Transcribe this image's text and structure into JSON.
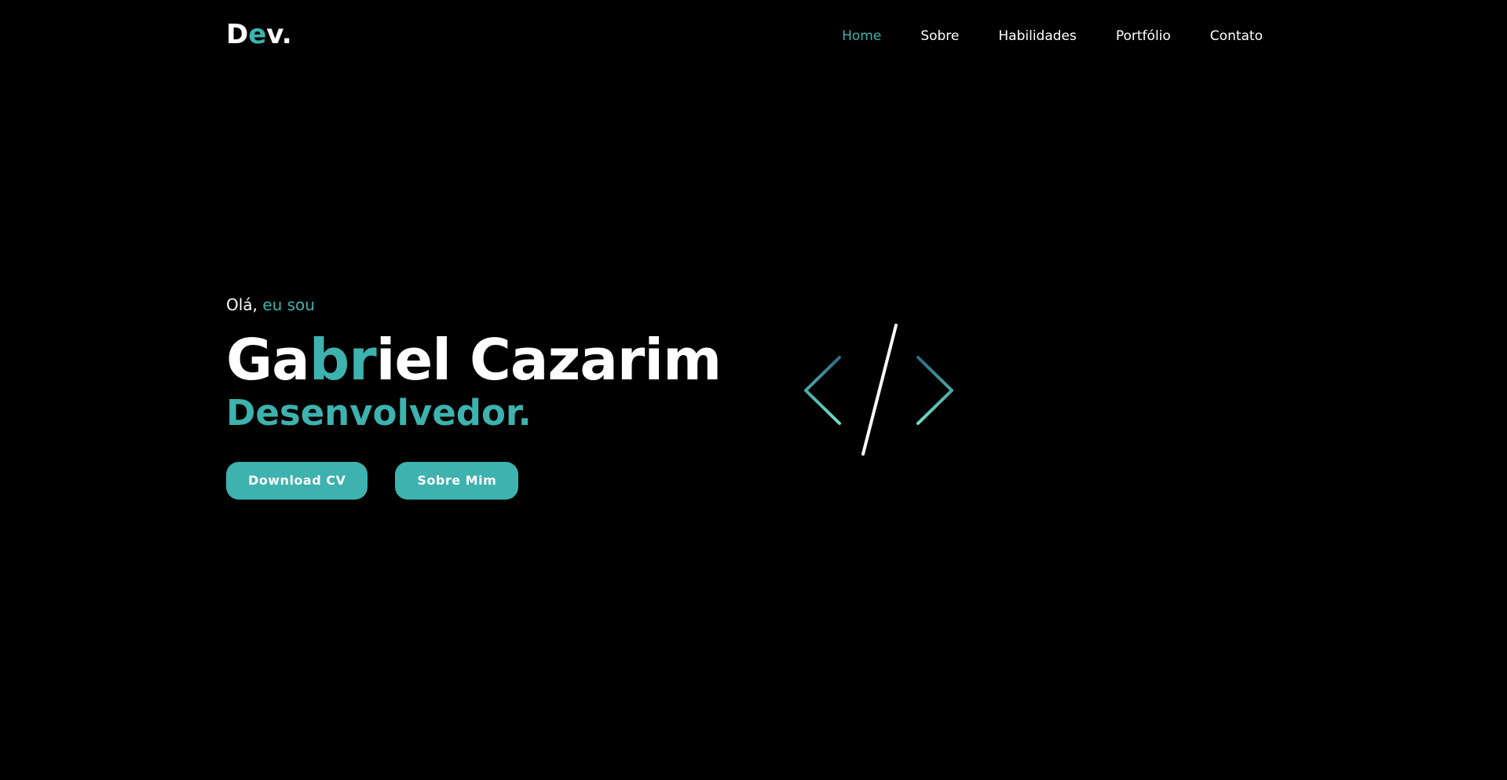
{
  "logo": {
    "part1": "D",
    "part2": "e",
    "part3": "v."
  },
  "nav": {
    "items": [
      {
        "label": "Home"
      },
      {
        "label": "Sobre"
      },
      {
        "label": "Habilidades"
      },
      {
        "label": "Portfólio"
      },
      {
        "label": "Contato"
      }
    ],
    "active": "Home"
  },
  "hero": {
    "greeting_plain": "Olá, ",
    "greeting_accent": "eu sou",
    "name_part1": "Ga",
    "name_part2": "br",
    "name_part3": "iel Cazarim",
    "role": "Desenvolvedor.",
    "button_download": "Download CV",
    "button_about": "Sobre Mim"
  },
  "code_icon": "code-brackets-icon",
  "colors": {
    "background": "#000000",
    "accent": "#3db2ae",
    "text": "#ffffff"
  }
}
